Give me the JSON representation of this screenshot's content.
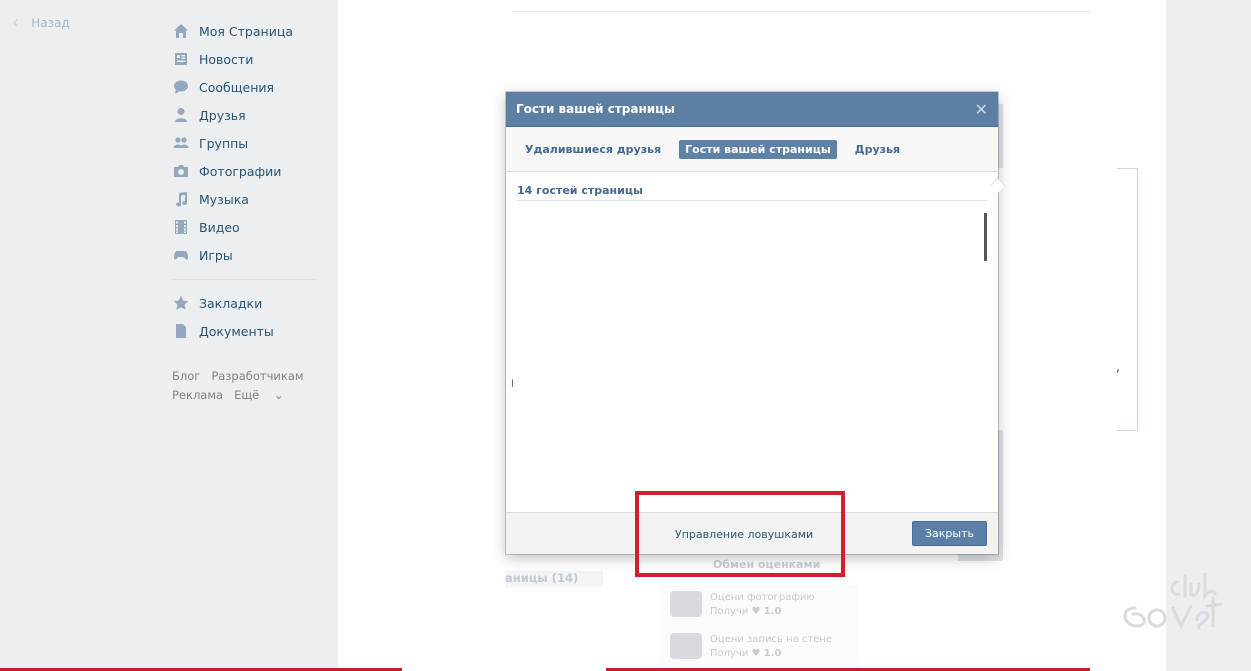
{
  "back": {
    "label": "Назад"
  },
  "nav": {
    "items": [
      {
        "label": "Моя Страница",
        "icon": "home-icon"
      },
      {
        "label": "Новости",
        "icon": "news-icon"
      },
      {
        "label": "Сообщения",
        "icon": "messages-icon"
      },
      {
        "label": "Друзья",
        "icon": "friends-icon"
      },
      {
        "label": "Группы",
        "icon": "groups-icon"
      },
      {
        "label": "Фотографии",
        "icon": "camera-icon"
      },
      {
        "label": "Музыка",
        "icon": "music-icon"
      },
      {
        "label": "Видео",
        "icon": "video-icon"
      },
      {
        "label": "Игры",
        "icon": "gamepad-icon"
      }
    ],
    "items2": [
      {
        "label": "Закладки",
        "icon": "star-icon"
      },
      {
        "label": "Документы",
        "icon": "document-icon"
      }
    ]
  },
  "footer": {
    "blog": "Блог",
    "dev": "Разработчикам",
    "ads": "Реклама",
    "more": "Ещё"
  },
  "modal": {
    "title": "Гости вашей страницы",
    "close_symbol": "✕",
    "tabs": [
      "Удалившиеся друзья",
      "Гости вашей страницы",
      "Друзья"
    ],
    "active_tab": 1,
    "section_title": "14 гостей страницы",
    "traps_link": "Управление ловушками",
    "close_button": "Закрыть"
  },
  "background": {
    "tab_fragment": "аницы (14)",
    "exchange_title": "Обмен оценками",
    "rows": [
      {
        "line1": "Оцени фотографию",
        "line2": "Получи",
        "value": "1.0"
      },
      {
        "line1": "Оцени запись на стене",
        "line2": "Получи",
        "value": "1.0"
      }
    ]
  },
  "watermark": "club Sovet",
  "colors": {
    "accent": "#5d7fa3",
    "highlight": "#d11f2d",
    "nav_text": "#285473"
  }
}
